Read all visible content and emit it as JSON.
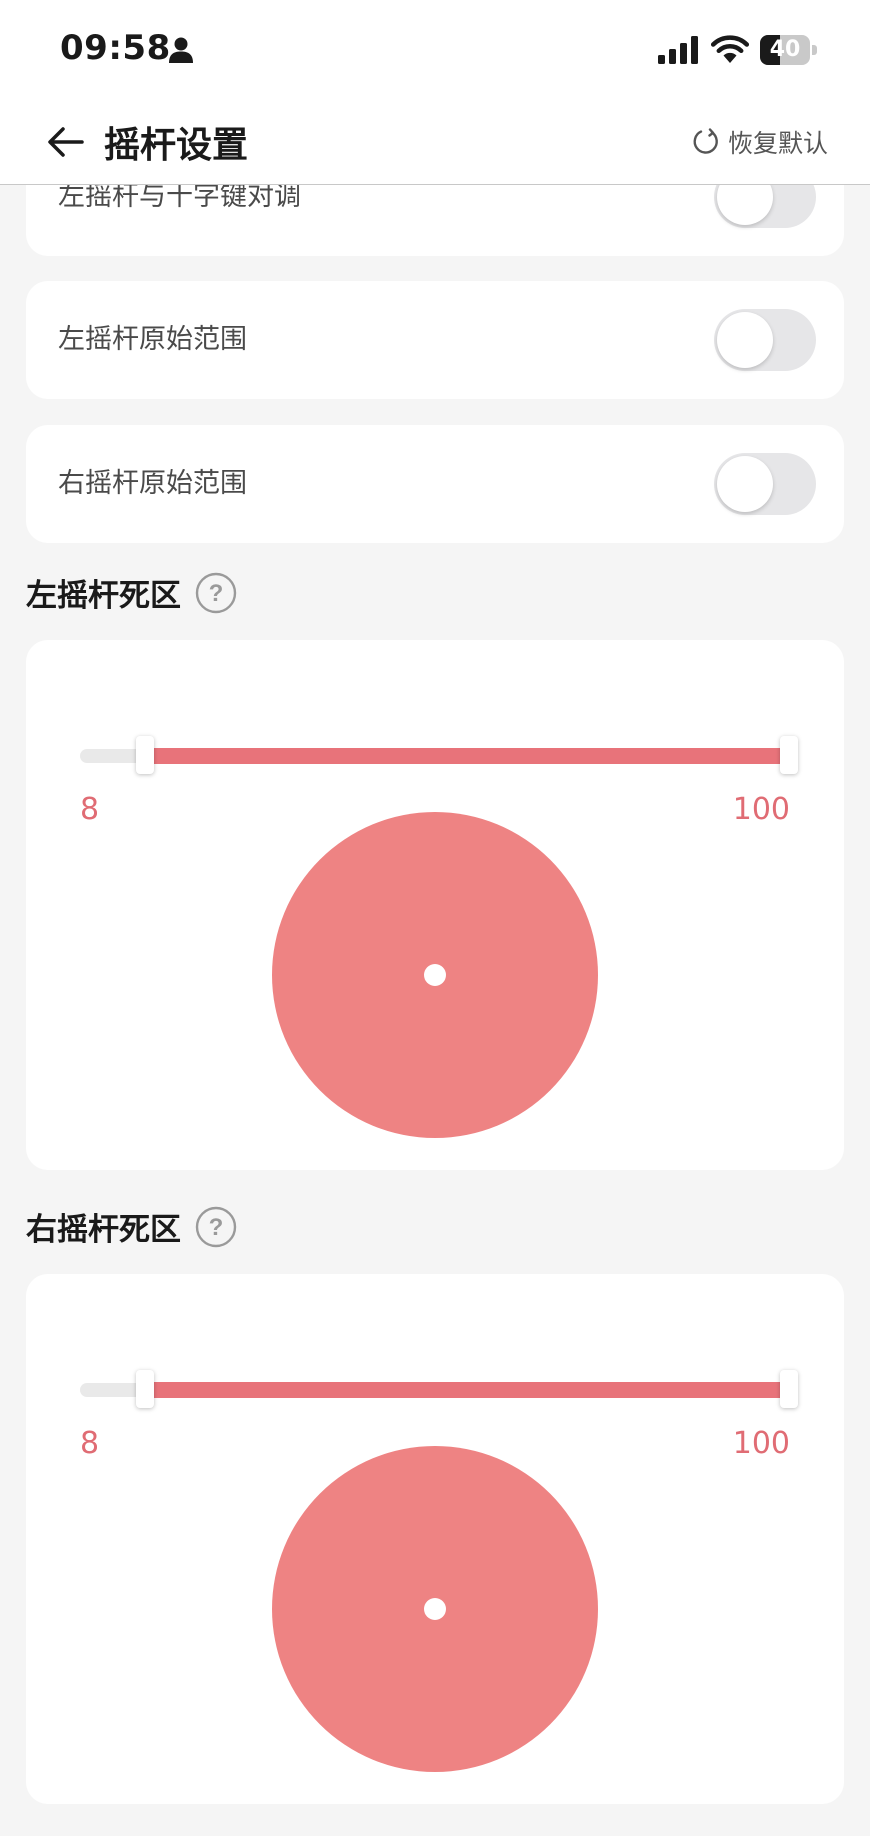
{
  "status_bar": {
    "time": "09:58",
    "battery_level": 40,
    "battery_text": "40"
  },
  "header": {
    "title": "摇杆设置",
    "reset_label": "恢复默认"
  },
  "toggles": [
    {
      "label": "左摇杆与十字键对调",
      "on": false
    },
    {
      "label": "左摇杆原始范围",
      "on": false
    },
    {
      "label": "右摇杆原始范围",
      "on": false
    }
  ],
  "deadzones": [
    {
      "title": "左摇杆死区",
      "min": 8,
      "max": 100,
      "min_label": "8",
      "max_label": "100"
    },
    {
      "title": "右摇杆死区",
      "min": 8,
      "max": 100,
      "min_label": "8",
      "max_label": "100"
    }
  ],
  "colors": {
    "accent": "#e8737a",
    "circle": "#ee8383",
    "label": "#e06c74"
  }
}
